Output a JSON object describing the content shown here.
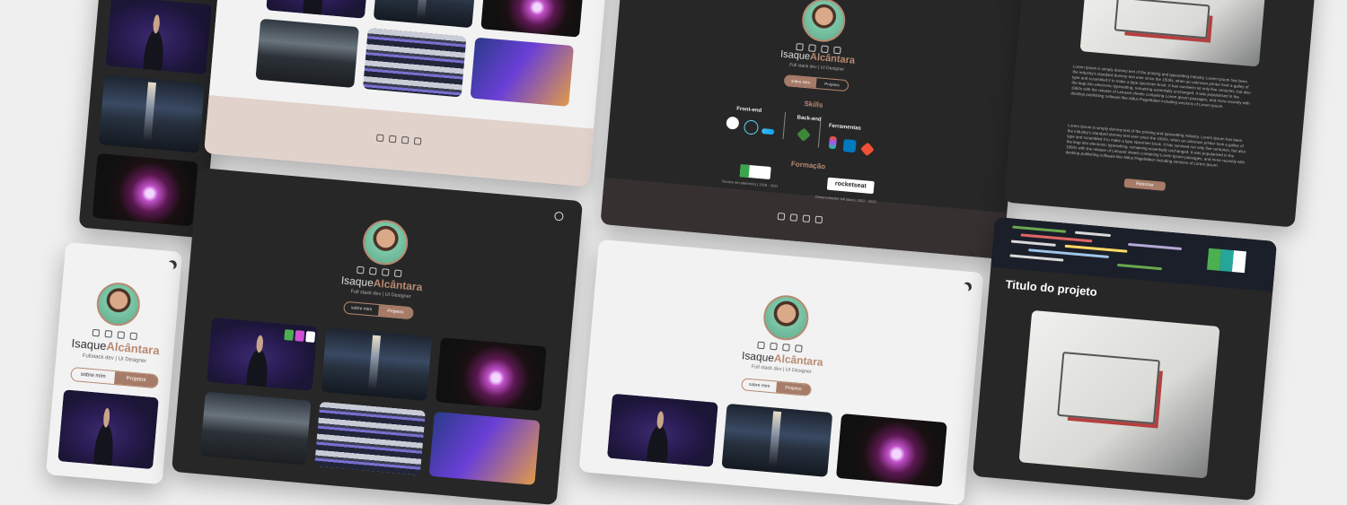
{
  "profile": {
    "first_name": "Isaque",
    "last_name": "Alcântara",
    "role_a": "Full stack dev | UI Designer",
    "role_b": "Fullstack dev | UI Designer"
  },
  "toggle": {
    "about": "sobre mim",
    "projects": "Projetos"
  },
  "skills": {
    "title": "Skills",
    "frontend": "Front-end",
    "backend": "Back-end",
    "tools": "Ferramentas"
  },
  "education": {
    "title": "Formação",
    "school1": "Técnico em eletrônica | 2019 - 2021",
    "school2": "Desenvolvedor full stack | 2022 - 2023",
    "rocketseat": "rocketseat"
  },
  "project": {
    "title": "Titulo do projeto",
    "back_button": "Retornar",
    "paragraph1": "Lorem Ipsum is simply dummy text of the printing and typesetting industry. Lorem Ipsum has been the industry's standard dummy text ever since the 1500s, when an unknown printer took a galley of type and scrambled it to make a type specimen book. It has survived not only five centuries, but also the leap into electronic typesetting, remaining essentially unchanged. It was popularised in the 1960s with the release of Letraset sheets containing Lorem Ipsum passages, and more recently with desktop publishing software like Aldus PageMaker including versions of Lorem Ipsum.",
    "paragraph2": "Lorem Ipsum is simply dummy text of the printing and typesetting industry. Lorem Ipsum has been the industry's standard dummy text ever since the 1500s, when an unknown printer took a galley of type and scrambled it to make a type specimen book. It has survived not only five centuries, but also the leap into electronic typesetting, remaining essentially unchanged. It was popularised in the 1960s with the release of Letraset sheets containing Lorem Ipsum passages, and more recently with desktop publishing software like Aldus PageMaker including versions of Lorem Ipsum."
  },
  "icons": {
    "theme_dark": "sun-icon",
    "theme_light": "moon-icon",
    "socials": [
      "instagram-icon",
      "twitter-icon",
      "linkedin-icon",
      "github-icon"
    ]
  },
  "colors": {
    "accent": "#b78a72",
    "dark_bg": "#272727",
    "light_bg": "#f2f2f2",
    "page_bg": "#efefef"
  }
}
